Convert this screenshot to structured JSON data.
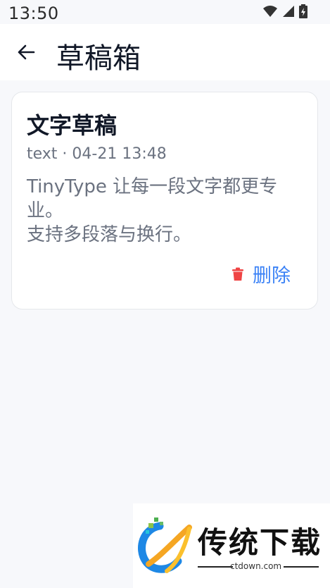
{
  "status": {
    "time": "13:50"
  },
  "header": {
    "title": "草稿箱"
  },
  "draft": {
    "title": "文字草稿",
    "meta": "text · 04-21 13:48",
    "body": "TinyType 让每一段文字都更专业。\n支持多段落与换行。",
    "delete_label": "删除"
  },
  "watermark": {
    "name": "传统下载",
    "site": "ctdown.com"
  },
  "colors": {
    "accent": "#3b82f6",
    "danger": "#ef4444",
    "background": "#f7f8fb"
  },
  "icons": {
    "back": "arrow-left-icon",
    "delete": "trash-icon",
    "wifi": "wifi-icon",
    "signal": "signal-icon",
    "battery": "battery-icon"
  }
}
